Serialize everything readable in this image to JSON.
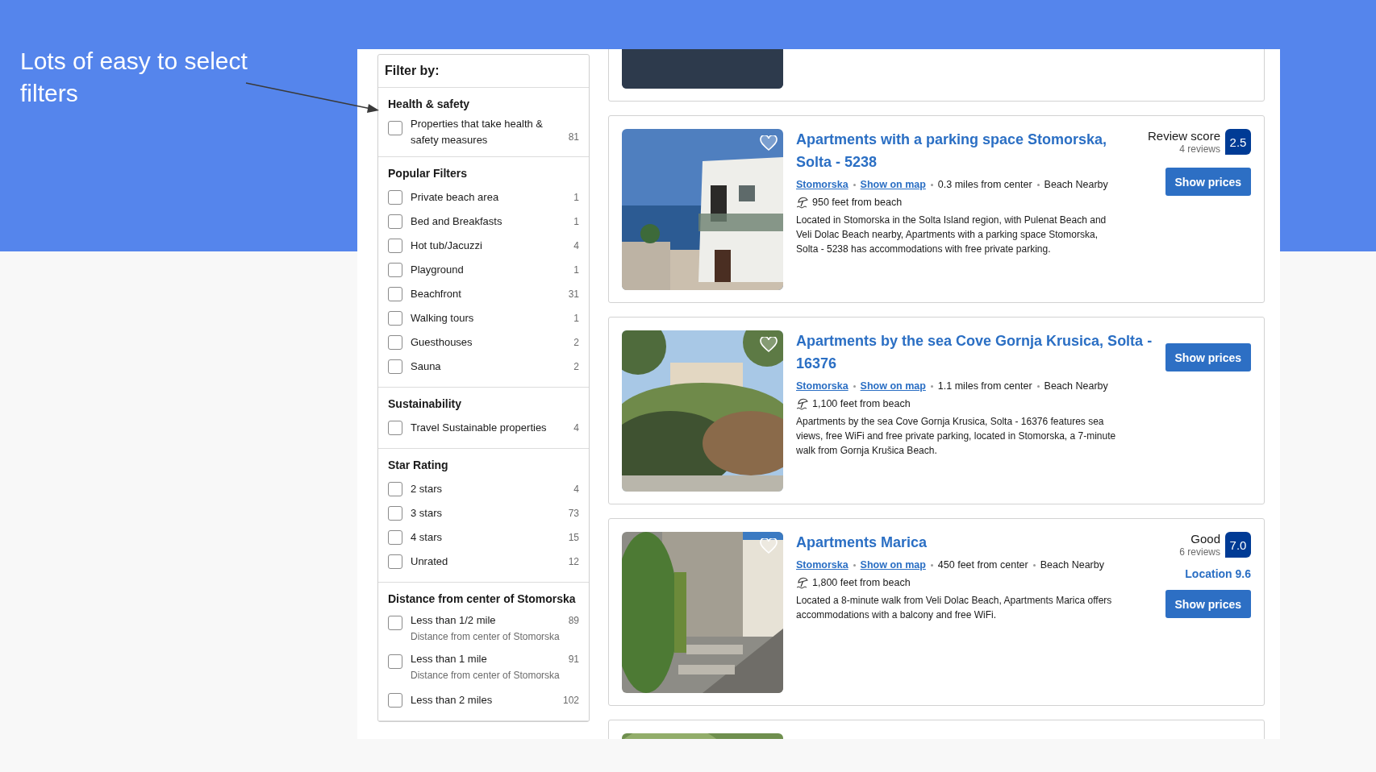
{
  "slide": {
    "caption": "Lots of easy to select filters"
  },
  "filters": {
    "heading": "Filter by:",
    "groups": [
      {
        "title": "Health & safety",
        "options": [
          {
            "label": "Properties that take health & safety measures",
            "count": "81",
            "checked": false
          }
        ]
      },
      {
        "title": "Popular Filters",
        "options": [
          {
            "label": "Private beach area",
            "count": "1",
            "checked": false
          },
          {
            "label": "Bed and Breakfasts",
            "count": "1",
            "checked": false
          },
          {
            "label": "Hot tub/Jacuzzi",
            "count": "4",
            "checked": false
          },
          {
            "label": "Playground",
            "count": "1",
            "checked": false
          },
          {
            "label": "Beachfront",
            "count": "31",
            "checked": false
          },
          {
            "label": "Walking tours",
            "count": "1",
            "checked": false
          },
          {
            "label": "Guesthouses",
            "count": "2",
            "checked": false
          },
          {
            "label": "Sauna",
            "count": "2",
            "checked": false
          }
        ]
      },
      {
        "title": "Sustainability",
        "options": [
          {
            "label": "Travel Sustainable properties",
            "count": "4",
            "checked": false
          }
        ]
      },
      {
        "title": "Star Rating",
        "options": [
          {
            "label": "2 stars",
            "count": "4",
            "checked": false
          },
          {
            "label": "3 stars",
            "count": "73",
            "checked": false
          },
          {
            "label": "4 stars",
            "count": "15",
            "checked": false
          },
          {
            "label": "Unrated",
            "count": "12",
            "checked": false
          }
        ]
      },
      {
        "title": "Distance from center of Stomorska",
        "options": [
          {
            "label": "Less than 1/2 mile",
            "count": "89",
            "note": "Distance from center of Stomorska",
            "checked": false
          },
          {
            "label": "Less than 1 mile",
            "count": "91",
            "note": "Distance from center of Stomorska",
            "checked": false
          },
          {
            "label": "Less than 2 miles",
            "count": "102",
            "checked": false
          }
        ]
      }
    ]
  },
  "results": [
    {
      "kind": "partial"
    },
    {
      "kind": "listing",
      "title": "Apartments with a parking space Stomorska, Solta - 5238",
      "town": "Stomorska",
      "map_link": "Show on map",
      "distance": "0.3 miles from center",
      "beach_tag": "Beach Nearby",
      "beach_distance": "950 feet from beach",
      "description": "Located in Stomorska in the Solta Island region, with Pulenat Beach and Veli Dolac Beach nearby, Apartments with a parking space Stomorska, Solta - 5238 has accommodations with free private parking.",
      "score_label": "Review score",
      "reviews": "4 reviews",
      "score": "2.5",
      "button": "Show prices"
    },
    {
      "kind": "listing",
      "title": "Apartments by the sea Cove Gornja Krusica, Solta - 16376",
      "town": "Stomorska",
      "map_link": "Show on map",
      "distance": "1.1 miles from center",
      "beach_tag": "Beach Nearby",
      "beach_distance": "1,100 feet from beach",
      "description": "Apartments by the sea Cove Gornja Krusica, Solta - 16376 features sea views, free WiFi and free private parking, located in Stomorska, a 7-minute walk from Gornja Krušica Beach.",
      "button": "Show prices"
    },
    {
      "kind": "listing",
      "title": "Apartments Marica",
      "town": "Stomorska",
      "map_link": "Show on map",
      "distance": "450 feet from center",
      "beach_tag": "Beach Nearby",
      "beach_distance": "1,800 feet from beach",
      "description": "Located a 8-minute walk from Veli Dolac Beach, Apartments Marica offers accommodations with a balcony and free WiFi.",
      "score_label": "Good",
      "reviews": "6 reviews",
      "score": "7.0",
      "location_score": "Location 9.6",
      "button": "Show prices"
    },
    {
      "kind": "partial"
    }
  ]
}
